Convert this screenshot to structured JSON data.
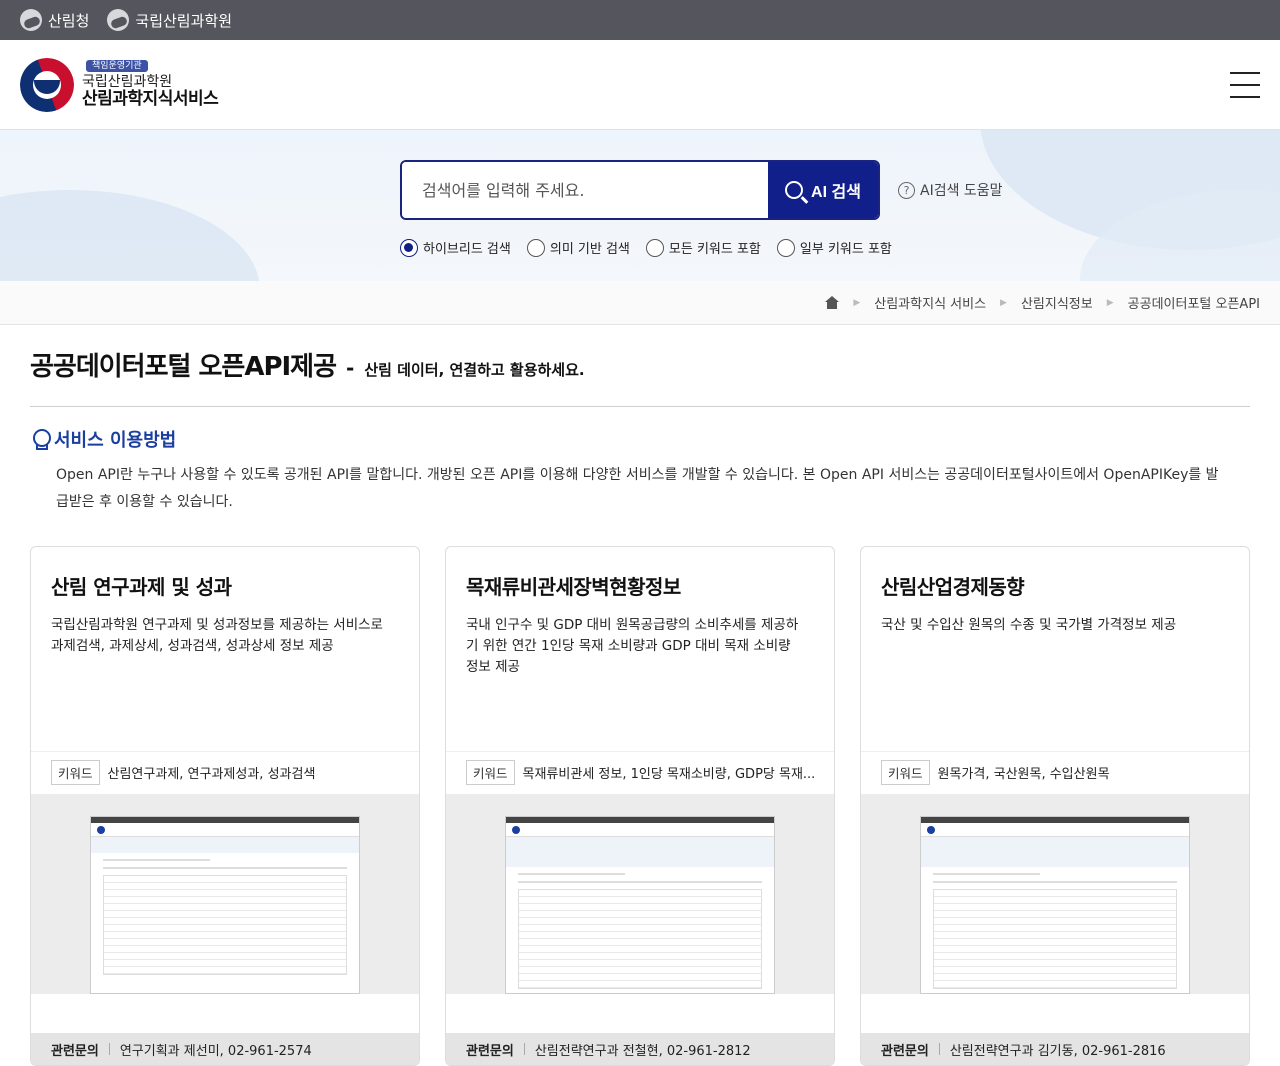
{
  "topbar": {
    "links": [
      "산림청",
      "국립산림과학원"
    ]
  },
  "header": {
    "badge": "책임운영기관",
    "org": "국립산림과학원",
    "service": "산림과학지식서비스"
  },
  "search": {
    "placeholder": "검색어를 입력해 주세요.",
    "button_label": "AI 검색",
    "help_label": "AI검색 도움말",
    "options": [
      {
        "label": "하이브리드 검색",
        "checked": true
      },
      {
        "label": "의미 기반 검색",
        "checked": false
      },
      {
        "label": "모든 키워드 포함",
        "checked": false
      },
      {
        "label": "일부 키워드 포함",
        "checked": false
      }
    ]
  },
  "breadcrumb": [
    "산림과학지식 서비스",
    "산림지식정보",
    "공공데이터포털 오픈API"
  ],
  "page": {
    "title": "공공데이터포털 오픈API제공",
    "dash": "-",
    "subtitle": "산림 데이터, 연결하고 활용하세요."
  },
  "section": {
    "heading": "서비스 이용방법",
    "description": "Open API란 누구나 사용할 수 있도록 공개된 API를 말합니다. 개방된 오픈 API를 이용해 다양한 서비스를 개발할 수 있습니다. 본 Open API 서비스는 공공데이터포털사이트에서 OpenAPIKey를 발급받은 후 이용할 수 있습니다."
  },
  "cards": [
    {
      "title": "산림 연구과제 및 성과",
      "description": "국립산림과학원 연구과제 및 성과정보를 제공하는 서비스로 과제검색, 과제상세, 성과검색, 성과상세 정보 제공",
      "keyword_tag": "키워드",
      "keywords": "산림연구과제, 연구과제성과, 성과검색",
      "contact_label": "관련문의",
      "contact": "연구기획과 제선미, 02-961-2574"
    },
    {
      "title": "목재류비관세장벽현황정보",
      "description": "국내 인구수 및 GDP 대비 원목공급량의 소비추세를 제공하기 위한 연간 1인당 목재 소비량과 GDP 대비 목재 소비량 정보 제공",
      "keyword_tag": "키워드",
      "keywords": "목재류비관세 정보, 1인당 목재소비량, GDP당 목재...",
      "contact_label": "관련문의",
      "contact": "산림전략연구과 전철현, 02-961-2812"
    },
    {
      "title": "산림산업경제동향",
      "description": "국산 및 수입산 원목의 수종 및 국가별 가격정보 제공",
      "keyword_tag": "키워드",
      "keywords": "원목가격, 국산원목, 수입산원목",
      "contact_label": "관련문의",
      "contact": "산림전략연구과 김기동, 02-961-2816"
    }
  ]
}
